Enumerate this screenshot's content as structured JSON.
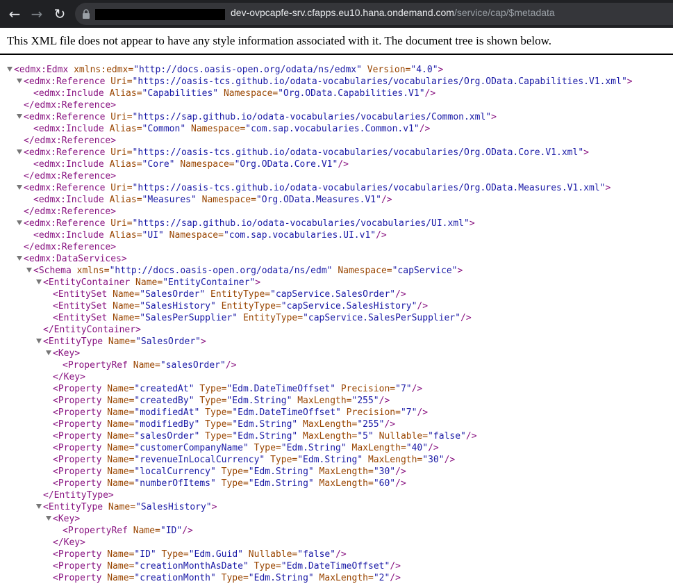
{
  "browser": {
    "url_host": "dev-ovpcapfe-srv.cfapps.eu10.hana.ondemand.com",
    "url_path": "/service/cap/$metadata"
  },
  "viewer": {
    "info": "This XML file does not appear to have any style information associated with it. The document tree is shown below."
  },
  "lines": [
    {
      "indent": 0,
      "toggle": true,
      "kind": "open",
      "tag": "edmx:Edmx",
      "attrs": [
        [
          "xmlns:edmx",
          "http://docs.oasis-open.org/odata/ns/edmx"
        ],
        [
          "Version",
          "4.0"
        ]
      ]
    },
    {
      "indent": 1,
      "toggle": true,
      "kind": "open",
      "tag": "edmx:Reference",
      "attrs": [
        [
          "Uri",
          "https://oasis-tcs.github.io/odata-vocabularies/vocabularies/Org.OData.Capabilities.V1.xml"
        ]
      ]
    },
    {
      "indent": 2,
      "toggle": false,
      "kind": "self",
      "tag": "edmx:Include",
      "attrs": [
        [
          "Alias",
          "Capabilities"
        ],
        [
          "Namespace",
          "Org.OData.Capabilities.V1"
        ]
      ]
    },
    {
      "indent": 1,
      "toggle": false,
      "kind": "close",
      "tag": "edmx:Reference",
      "attrs": []
    },
    {
      "indent": 1,
      "toggle": true,
      "kind": "open",
      "tag": "edmx:Reference",
      "attrs": [
        [
          "Uri",
          "https://sap.github.io/odata-vocabularies/vocabularies/Common.xml"
        ]
      ]
    },
    {
      "indent": 2,
      "toggle": false,
      "kind": "self",
      "tag": "edmx:Include",
      "attrs": [
        [
          "Alias",
          "Common"
        ],
        [
          "Namespace",
          "com.sap.vocabularies.Common.v1"
        ]
      ]
    },
    {
      "indent": 1,
      "toggle": false,
      "kind": "close",
      "tag": "edmx:Reference",
      "attrs": []
    },
    {
      "indent": 1,
      "toggle": true,
      "kind": "open",
      "tag": "edmx:Reference",
      "attrs": [
        [
          "Uri",
          "https://oasis-tcs.github.io/odata-vocabularies/vocabularies/Org.OData.Core.V1.xml"
        ]
      ]
    },
    {
      "indent": 2,
      "toggle": false,
      "kind": "self",
      "tag": "edmx:Include",
      "attrs": [
        [
          "Alias",
          "Core"
        ],
        [
          "Namespace",
          "Org.OData.Core.V1"
        ]
      ]
    },
    {
      "indent": 1,
      "toggle": false,
      "kind": "close",
      "tag": "edmx:Reference",
      "attrs": []
    },
    {
      "indent": 1,
      "toggle": true,
      "kind": "open",
      "tag": "edmx:Reference",
      "attrs": [
        [
          "Uri",
          "https://oasis-tcs.github.io/odata-vocabularies/vocabularies/Org.OData.Measures.V1.xml"
        ]
      ]
    },
    {
      "indent": 2,
      "toggle": false,
      "kind": "self",
      "tag": "edmx:Include",
      "attrs": [
        [
          "Alias",
          "Measures"
        ],
        [
          "Namespace",
          "Org.OData.Measures.V1"
        ]
      ]
    },
    {
      "indent": 1,
      "toggle": false,
      "kind": "close",
      "tag": "edmx:Reference",
      "attrs": []
    },
    {
      "indent": 1,
      "toggle": true,
      "kind": "open",
      "tag": "edmx:Reference",
      "attrs": [
        [
          "Uri",
          "https://sap.github.io/odata-vocabularies/vocabularies/UI.xml"
        ]
      ]
    },
    {
      "indent": 2,
      "toggle": false,
      "kind": "self",
      "tag": "edmx:Include",
      "attrs": [
        [
          "Alias",
          "UI"
        ],
        [
          "Namespace",
          "com.sap.vocabularies.UI.v1"
        ]
      ]
    },
    {
      "indent": 1,
      "toggle": false,
      "kind": "close",
      "tag": "edmx:Reference",
      "attrs": []
    },
    {
      "indent": 1,
      "toggle": true,
      "kind": "open",
      "tag": "edmx:DataServices",
      "attrs": []
    },
    {
      "indent": 2,
      "toggle": true,
      "kind": "open",
      "tag": "Schema",
      "attrs": [
        [
          "xmlns",
          "http://docs.oasis-open.org/odata/ns/edm"
        ],
        [
          "Namespace",
          "capService"
        ]
      ]
    },
    {
      "indent": 3,
      "toggle": true,
      "kind": "open",
      "tag": "EntityContainer",
      "attrs": [
        [
          "Name",
          "EntityContainer"
        ]
      ]
    },
    {
      "indent": 4,
      "toggle": false,
      "kind": "self",
      "tag": "EntitySet",
      "attrs": [
        [
          "Name",
          "SalesOrder"
        ],
        [
          "EntityType",
          "capService.SalesOrder"
        ]
      ]
    },
    {
      "indent": 4,
      "toggle": false,
      "kind": "self",
      "tag": "EntitySet",
      "attrs": [
        [
          "Name",
          "SalesHistory"
        ],
        [
          "EntityType",
          "capService.SalesHistory"
        ]
      ]
    },
    {
      "indent": 4,
      "toggle": false,
      "kind": "self",
      "tag": "EntitySet",
      "attrs": [
        [
          "Name",
          "SalesPerSupplier"
        ],
        [
          "EntityType",
          "capService.SalesPerSupplier"
        ]
      ]
    },
    {
      "indent": 3,
      "toggle": false,
      "kind": "close",
      "tag": "EntityContainer",
      "attrs": []
    },
    {
      "indent": 3,
      "toggle": true,
      "kind": "open",
      "tag": "EntityType",
      "attrs": [
        [
          "Name",
          "SalesOrder"
        ]
      ]
    },
    {
      "indent": 4,
      "toggle": true,
      "kind": "open",
      "tag": "Key",
      "attrs": []
    },
    {
      "indent": 5,
      "toggle": false,
      "kind": "self",
      "tag": "PropertyRef",
      "attrs": [
        [
          "Name",
          "salesOrder"
        ]
      ]
    },
    {
      "indent": 4,
      "toggle": false,
      "kind": "close",
      "tag": "Key",
      "attrs": []
    },
    {
      "indent": 4,
      "toggle": false,
      "kind": "self",
      "tag": "Property",
      "attrs": [
        [
          "Name",
          "createdAt"
        ],
        [
          "Type",
          "Edm.DateTimeOffset"
        ],
        [
          "Precision",
          "7"
        ]
      ]
    },
    {
      "indent": 4,
      "toggle": false,
      "kind": "self",
      "tag": "Property",
      "attrs": [
        [
          "Name",
          "createdBy"
        ],
        [
          "Type",
          "Edm.String"
        ],
        [
          "MaxLength",
          "255"
        ]
      ]
    },
    {
      "indent": 4,
      "toggle": false,
      "kind": "self",
      "tag": "Property",
      "attrs": [
        [
          "Name",
          "modifiedAt"
        ],
        [
          "Type",
          "Edm.DateTimeOffset"
        ],
        [
          "Precision",
          "7"
        ]
      ]
    },
    {
      "indent": 4,
      "toggle": false,
      "kind": "self",
      "tag": "Property",
      "attrs": [
        [
          "Name",
          "modifiedBy"
        ],
        [
          "Type",
          "Edm.String"
        ],
        [
          "MaxLength",
          "255"
        ]
      ]
    },
    {
      "indent": 4,
      "toggle": false,
      "kind": "self",
      "tag": "Property",
      "attrs": [
        [
          "Name",
          "salesOrder"
        ],
        [
          "Type",
          "Edm.String"
        ],
        [
          "MaxLength",
          "5"
        ],
        [
          "Nullable",
          "false"
        ]
      ]
    },
    {
      "indent": 4,
      "toggle": false,
      "kind": "self",
      "tag": "Property",
      "attrs": [
        [
          "Name",
          "customerCompanyName"
        ],
        [
          "Type",
          "Edm.String"
        ],
        [
          "MaxLength",
          "40"
        ]
      ]
    },
    {
      "indent": 4,
      "toggle": false,
      "kind": "self",
      "tag": "Property",
      "attrs": [
        [
          "Name",
          "revenueInLocalCurrency"
        ],
        [
          "Type",
          "Edm.String"
        ],
        [
          "MaxLength",
          "30"
        ]
      ]
    },
    {
      "indent": 4,
      "toggle": false,
      "kind": "self",
      "tag": "Property",
      "attrs": [
        [
          "Name",
          "localCurrency"
        ],
        [
          "Type",
          "Edm.String"
        ],
        [
          "MaxLength",
          "30"
        ]
      ]
    },
    {
      "indent": 4,
      "toggle": false,
      "kind": "self",
      "tag": "Property",
      "attrs": [
        [
          "Name",
          "numberOfItems"
        ],
        [
          "Type",
          "Edm.String"
        ],
        [
          "MaxLength",
          "60"
        ]
      ]
    },
    {
      "indent": 3,
      "toggle": false,
      "kind": "close",
      "tag": "EntityType",
      "attrs": []
    },
    {
      "indent": 3,
      "toggle": true,
      "kind": "open",
      "tag": "EntityType",
      "attrs": [
        [
          "Name",
          "SalesHistory"
        ]
      ]
    },
    {
      "indent": 4,
      "toggle": true,
      "kind": "open",
      "tag": "Key",
      "attrs": []
    },
    {
      "indent": 5,
      "toggle": false,
      "kind": "self",
      "tag": "PropertyRef",
      "attrs": [
        [
          "Name",
          "ID"
        ]
      ]
    },
    {
      "indent": 4,
      "toggle": false,
      "kind": "close",
      "tag": "Key",
      "attrs": []
    },
    {
      "indent": 4,
      "toggle": false,
      "kind": "self",
      "tag": "Property",
      "attrs": [
        [
          "Name",
          "ID"
        ],
        [
          "Type",
          "Edm.Guid"
        ],
        [
          "Nullable",
          "false"
        ]
      ]
    },
    {
      "indent": 4,
      "toggle": false,
      "kind": "self",
      "tag": "Property",
      "attrs": [
        [
          "Name",
          "creationMonthAsDate"
        ],
        [
          "Type",
          "Edm.DateTimeOffset"
        ]
      ]
    },
    {
      "indent": 4,
      "toggle": false,
      "kind": "self",
      "tag": "Property",
      "attrs": [
        [
          "Name",
          "creationMonth"
        ],
        [
          "Type",
          "Edm.String"
        ],
        [
          "MaxLength",
          "2"
        ]
      ]
    }
  ]
}
